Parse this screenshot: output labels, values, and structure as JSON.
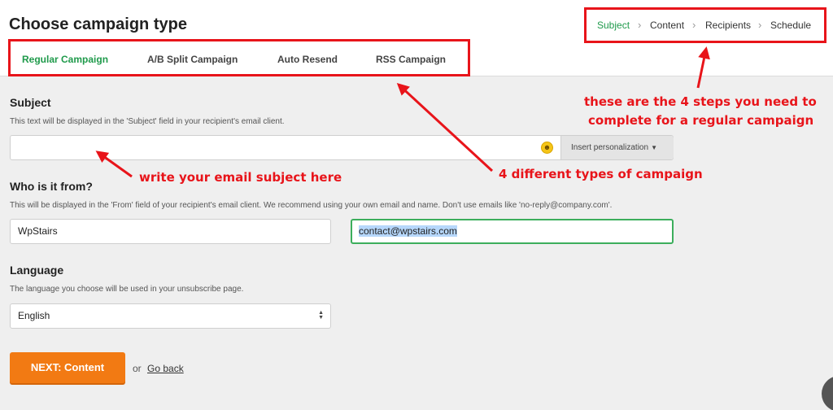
{
  "header": {
    "title": "Choose campaign type"
  },
  "tabs": [
    {
      "label": "Regular Campaign",
      "active": true
    },
    {
      "label": "A/B Split Campaign",
      "active": false
    },
    {
      "label": "Auto Resend",
      "active": false
    },
    {
      "label": "RSS Campaign",
      "active": false
    }
  ],
  "steps": [
    {
      "label": "Subject",
      "active": true
    },
    {
      "label": "Content",
      "active": false
    },
    {
      "label": "Recipients",
      "active": false
    },
    {
      "label": "Schedule",
      "active": false
    }
  ],
  "step_separator": "›",
  "subject": {
    "title": "Subject",
    "hint": "This text will be displayed in the 'Subject' field in your recipient's email client.",
    "value": "",
    "placeholder": "",
    "emoji_icon": "smiley-icon",
    "personalize_label": "Insert personalization"
  },
  "from": {
    "title": "Who is it from?",
    "hint": "This will be displayed in the 'From' field of your recipient's email client. We recommend using your own email and name. Don't use emails like 'no-reply@company.com'.",
    "name_value": "WpStairs",
    "email_value": "contact@wpstairs.com"
  },
  "language": {
    "title": "Language",
    "hint": "The language you choose will be used in your unsubscribe page.",
    "selected": "English"
  },
  "actions": {
    "next_label": "NEXT: Content",
    "or_text": "or",
    "back_label": "Go back"
  },
  "annotations": {
    "steps_note_line1": "these are the 4 steps you need to",
    "steps_note_line2": "complete for a regular campaign",
    "subject_note": "write your email subject here",
    "types_note": "4 different types of campaign"
  },
  "colors": {
    "accent_green": "#1f9a4b",
    "annotation_red": "#e8141a",
    "button_orange": "#f27a13",
    "selection_blue": "#b6d7fb"
  }
}
